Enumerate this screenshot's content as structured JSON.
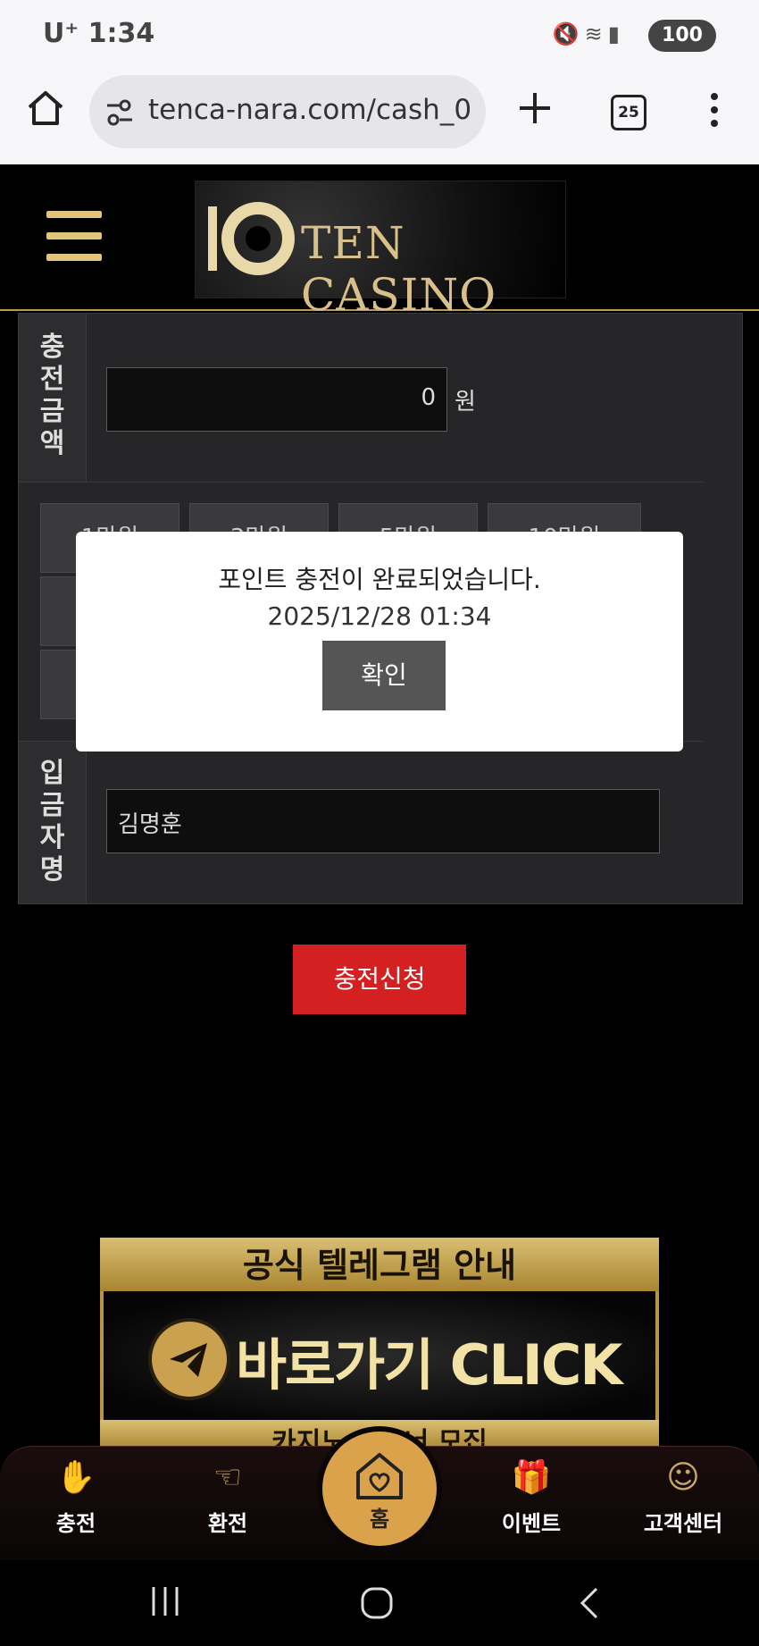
{
  "status_bar": {
    "carrier": "U⁺",
    "time": "1:34",
    "battery": "100"
  },
  "browser": {
    "url": "tenca-nara.com/cash_0",
    "tab_count": "25"
  },
  "site": {
    "logo_text": "TEN CASINO"
  },
  "form": {
    "amount_label": "충전금액",
    "amount_value": "0",
    "amount_unit": "원",
    "quick_buttons": [
      "1만원",
      "3만원",
      "5만원",
      "10만원"
    ],
    "depositor_label": "입금자명",
    "depositor_value": "김명훈",
    "submit_label": "충전신청"
  },
  "modal": {
    "message": "포인트 충전이 완료되었습니다.",
    "timestamp": "2025/12/28 01:34",
    "confirm_label": "확인"
  },
  "banner": {
    "title": "공식 텔레그램 안내",
    "cta": "바로가기 CLICK",
    "footer": "카지노 파트너 모집"
  },
  "bottom_nav": {
    "items": [
      {
        "label": "충전",
        "icon": "deposit-icon"
      },
      {
        "label": "환전",
        "icon": "withdraw-icon"
      },
      {
        "label": "홈",
        "icon": "home-heart-icon"
      },
      {
        "label": "이벤트",
        "icon": "gift-icon"
      },
      {
        "label": "고객센터",
        "icon": "support-icon"
      }
    ]
  },
  "colors": {
    "accent_gold": "#dba24c",
    "submit_red": "#d42020"
  }
}
